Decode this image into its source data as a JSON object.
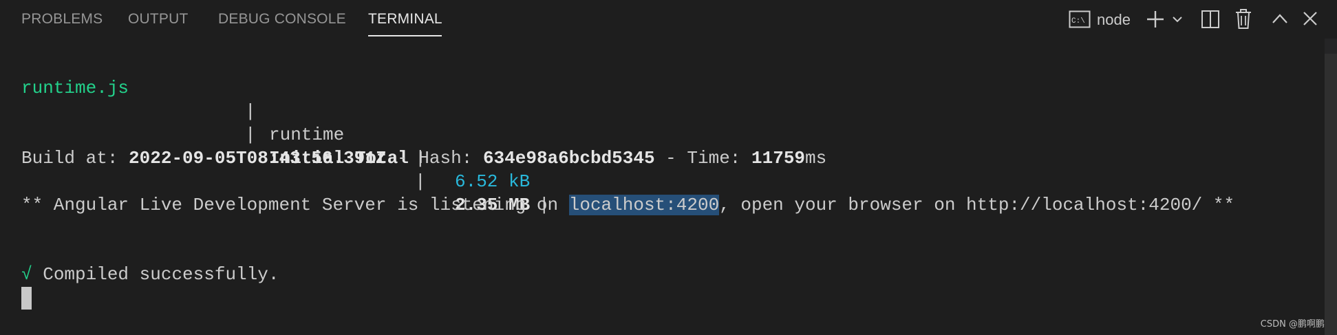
{
  "tabs": [
    {
      "label": "PROBLEMS",
      "active": false
    },
    {
      "label": "OUTPUT",
      "active": false
    },
    {
      "label": "DEBUG CONSOLE",
      "active": false
    },
    {
      "label": "TERMINAL",
      "active": true
    }
  ],
  "toolbar": {
    "terminal_name": "node",
    "icons": [
      "terminal-cmd-icon",
      "plus-icon",
      "chevron-down-icon",
      "split-icon",
      "trash-icon",
      "chevron-up-icon",
      "close-icon"
    ]
  },
  "terminal": {
    "row1": {
      "file": "runtime.js",
      "sep1": "|",
      "name": "runtime",
      "sep2": "|",
      "size": "6.52 kB",
      "sep3": "|"
    },
    "row2": {
      "sep1": "|",
      "name": "Initial Total",
      "sep2": "|",
      "size": "2.35 MB"
    },
    "build": {
      "label_build": "Build at: ",
      "date": "2022-09-05T08:43:56.391Z",
      "label_hash": " - Hash: ",
      "hash": "634e98a6bcbd5345",
      "label_time": " - Time: ",
      "time": "11759",
      "time_unit": "ms"
    },
    "server": {
      "prefix": "** Angular Live Development Server is listening on ",
      "host": "localhost:4200",
      "suffix": ", open your browser on http://localhost:4200/ **"
    },
    "compiled": {
      "check": "√",
      "message": " Compiled successfully."
    }
  },
  "watermark": "CSDN @鹏啊鹏",
  "colors": {
    "background": "#1e1e1e",
    "green": "#23d18b",
    "cyan": "#29b8db",
    "selection": "#264f78"
  }
}
